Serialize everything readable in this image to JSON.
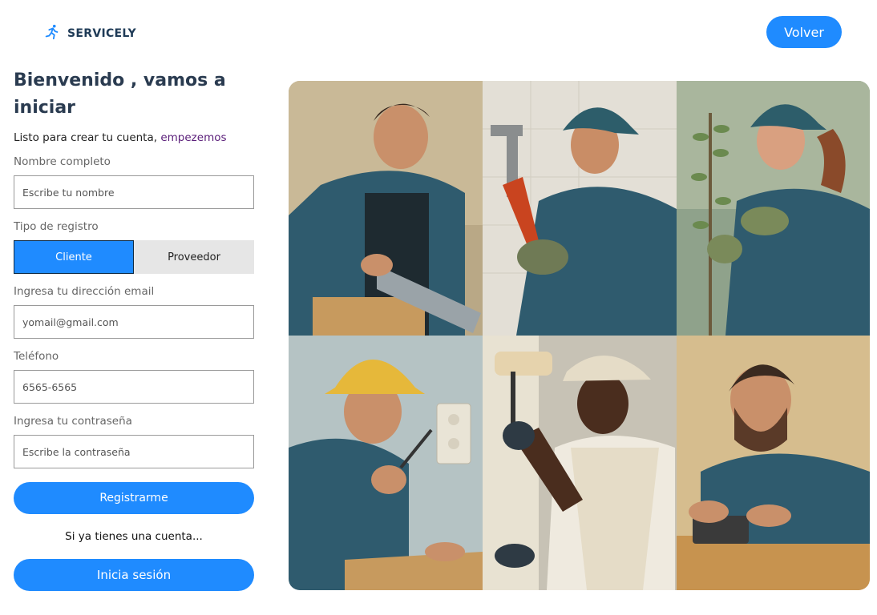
{
  "brand": {
    "name": "SERVICELY",
    "icon": "runner-icon"
  },
  "header": {
    "back_label": "Volver"
  },
  "form": {
    "title": "Bienvenido , vamos a iniciar",
    "subtitle_prefix": "Listo para crear tu cuenta,",
    "subtitle_accent": "empezemos",
    "name_label": "Nombre completo",
    "name_placeholder": "Escribe tu nombre",
    "type_label": "Tipo de registro",
    "type_options": [
      "Cliente",
      "Proveedor"
    ],
    "type_selected": "Cliente",
    "email_label": "Ingresa tu dirección email",
    "email_value": "yomail@gmail.com",
    "phone_label": "Teléfono",
    "phone_value": "6565-6565",
    "password_label": "Ingresa tu contraseña",
    "password_placeholder": "Escribe la contraseña",
    "register_label": "Registrarme",
    "have_account": "Si ya tienes una cuenta...",
    "login_label": "Inicia sesión"
  },
  "colors": {
    "accent": "#1f8bff",
    "title": "#2a3b50",
    "subtitle_accent": "#5b1f7a",
    "uniform": "#2f5b6e"
  }
}
